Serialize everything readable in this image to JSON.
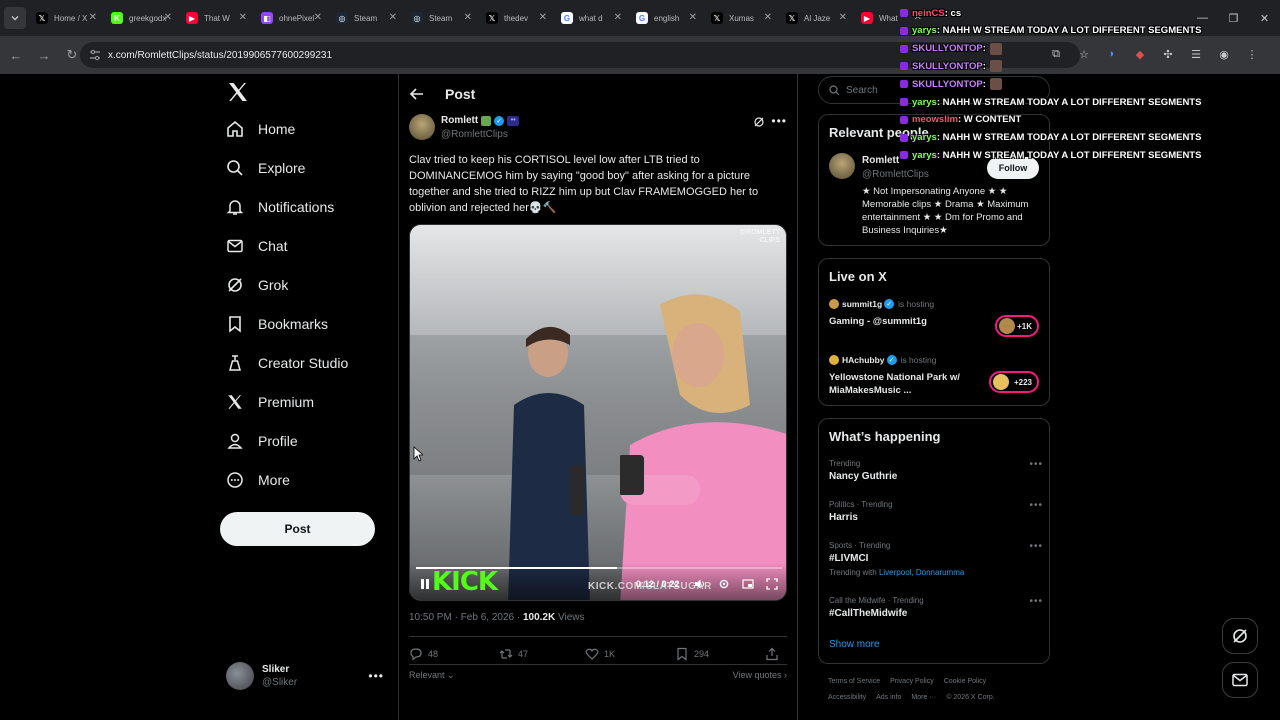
{
  "browser": {
    "tabs": [
      {
        "label": "Home / X",
        "icon": "x-logo-icon",
        "color": "#000000"
      },
      {
        "label": "greekgodx",
        "icon": "kick-icon",
        "color": "#53fc18"
      },
      {
        "label": "That W",
        "icon": "youtube-icon",
        "color": "#ff0033"
      },
      {
        "label": "ohnePixel",
        "icon": "twitch-icon",
        "color": "#9146ff"
      },
      {
        "label": "Steam",
        "icon": "steam-icon",
        "color": "#1b2838"
      },
      {
        "label": "Steam",
        "icon": "steam-icon",
        "color": "#1b2838"
      },
      {
        "label": "thedev",
        "icon": "x-logo-icon",
        "color": "#000000"
      },
      {
        "label": "what d",
        "icon": "google-icon",
        "color": "#ffffff"
      },
      {
        "label": "english",
        "icon": "google-icon",
        "color": "#ffffff"
      },
      {
        "label": "Xumas",
        "icon": "x-logo-icon",
        "color": "#000000"
      },
      {
        "label": "Al Jaze",
        "icon": "x-logo-icon",
        "color": "#000000"
      },
      {
        "label": "What",
        "icon": "youtube-icon",
        "color": "#ff0033"
      }
    ],
    "url": "x.com/RomlettClips/status/2019906577600299231"
  },
  "nav": {
    "items": [
      "Home",
      "Explore",
      "Notifications",
      "Chat",
      "Grok",
      "Bookmarks",
      "Creator Studio",
      "Premium",
      "Profile",
      "More"
    ],
    "post_button": "Post"
  },
  "account": {
    "name": "Sliker",
    "handle": "@Sliker"
  },
  "post": {
    "header": "Post",
    "author_name": "Romlett",
    "author_handle": "@RomlettClips",
    "text": "Clav tried to keep his CORTISOL level low after LTB tried to DOMINANCEMOG him by saying \"good boy\" after asking for a picture together and she tried to RIZZ him up but Clav FRAMEMOGGED her to oblivion and rejected her💀🔨",
    "video": {
      "watermark_line1": "@ROMLETT",
      "watermark_line2": "CLIPS",
      "kick_logo": "KICK",
      "kick_url": "KICK.COM/SLATSUGAR",
      "time": "0:12 / 0:22",
      "progress_fraction": 0.55
    },
    "timestamp": "10:50 PM · Feb 6, 2026 · ",
    "views_count": "100.2K",
    "views_label": " Views",
    "replies": "48",
    "reposts": "47",
    "likes": "1K",
    "bookmarks": "294",
    "sort_label": "Relevant",
    "view_quotes": "View quotes"
  },
  "sidebar": {
    "search_placeholder": "Search",
    "relevant_people": {
      "title": "Relevant people",
      "name": "Romlett",
      "handle": "@RomlettClips",
      "follow": "Follow",
      "bio": "★ Not Impersonating Anyone ★ ★ Memorable clips ★ Drama ★ Maximum entertainment ★ ★ Dm for Promo and Business Inquiries★"
    },
    "live": {
      "title": "Live on X",
      "items": [
        {
          "host": "summit1g",
          "hosting": "is hosting",
          "title": "Gaming - @summit1g",
          "count": "+1K"
        },
        {
          "host": "HAchubby",
          "hosting": "is hosting",
          "title": "Yellowstone National Park w/ MiaMakesMusic ...",
          "count": "+223"
        }
      ]
    },
    "happening": {
      "title": "What’s happening",
      "trends": [
        {
          "context": "Trending",
          "title": "Nancy Guthrie",
          "with_label": "",
          "with_links": ""
        },
        {
          "context": "Politics · Trending",
          "title": "Harris",
          "with_label": "",
          "with_links": ""
        },
        {
          "context": "Sports · Trending",
          "title": "#LIVMCI",
          "with_label": "Trending with ",
          "with_links": "Liverpool, Donnarumma"
        },
        {
          "context": "Call the Midwife · Trending",
          "title": "#CallTheMidwife",
          "with_label": "",
          "with_links": ""
        }
      ],
      "show_more": "Show more"
    },
    "footer": {
      "links1": [
        "Terms of Service",
        "Privacy Policy",
        "Cookie Policy"
      ],
      "links2": [
        "Accessibility",
        "Ads info",
        "More ···",
        "© 2026 X Corp."
      ]
    }
  },
  "chat": [
    {
      "user": "neinCS",
      "color": "#ff4d6d",
      "msg": ": cs",
      "emote": false
    },
    {
      "user": "yarys",
      "color": "#7dff5a",
      "msg": ": NAHH W STREAM TODAY A LOT DIFFERENT SEGMENTS",
      "emote": false
    },
    {
      "user": "SKULLYONTOP",
      "color": "#c77dff",
      "msg": " :",
      "emote": true
    },
    {
      "user": "SKULLYONTOP",
      "color": "#c77dff",
      "msg": " :",
      "emote": true
    },
    {
      "user": "SKULLYONTOP",
      "color": "#c77dff",
      "msg": " :",
      "emote": true
    },
    {
      "user": "yarys",
      "color": "#7dff5a",
      "msg": ": NAHH W STREAM TODAY A LOT DIFFERENT SEGMENTS",
      "emote": false
    },
    {
      "user": "meowslim",
      "color": "#ff4d6d",
      "msg": ": W CONTENT",
      "emote": false
    },
    {
      "user": "yarys",
      "color": "#7dff5a",
      "msg": ": NAHH W STREAM TODAY A LOT DIFFERENT SEGMENTS",
      "emote": false
    },
    {
      "user": "yarys",
      "color": "#7dff5a",
      "msg": ": NAHH W STREAM TODAY A LOT DIFFERENT SEGMENTS",
      "emote": false
    }
  ],
  "colors": {
    "accent": "#1d9bf0",
    "live": "#f91880",
    "kick": "#53fc18"
  }
}
